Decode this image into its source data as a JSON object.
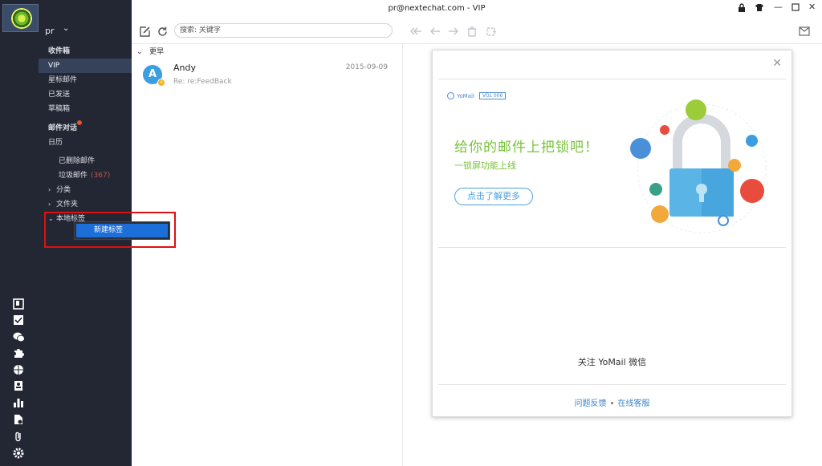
{
  "window": {
    "title": "pr@nextechat.com - VIP",
    "controls": [
      "lock-icon",
      "skin-icon",
      "minimize-icon",
      "maximize-icon",
      "close-icon"
    ]
  },
  "account": {
    "name": "pr"
  },
  "sidebar": {
    "items": [
      {
        "label": "收件箱"
      },
      {
        "label": "VIP"
      },
      {
        "label": "星标邮件"
      },
      {
        "label": "已发送"
      },
      {
        "label": "草稿箱"
      },
      {
        "label": "邮件对话"
      },
      {
        "label": "日历"
      },
      {
        "label": "已删除邮件"
      },
      {
        "label": "垃圾邮件",
        "count": "(367)"
      },
      {
        "label": "分类"
      },
      {
        "label": "文件夹"
      },
      {
        "label": "本地标签"
      }
    ],
    "bottom_icons": [
      "notes-icon",
      "tasks-icon",
      "wechat-icon",
      "puzzle-icon",
      "globe-icon",
      "contacts-icon",
      "stats-icon",
      "files-icon",
      "attachment-icon",
      "settings-icon"
    ]
  },
  "context_menu": {
    "items": [
      {
        "label": "新建标签"
      }
    ]
  },
  "toolbar": {
    "search_placeholder": "搜索: 关键字"
  },
  "mail_list": {
    "group_label": "更早",
    "items": [
      {
        "avatar_letter": "A",
        "sender": "Andy",
        "date": "2015-09-09",
        "subject": "Re: re:FeedBack"
      }
    ]
  },
  "reading_pane": {
    "logo_text": "YoMail",
    "vol_tag": "VOL 006",
    "banner_title": "给你的邮件上把锁吧！",
    "banner_subtitle": "一锁屏功能上线",
    "banner_button": "点击了解更多",
    "follow_text": "关注 YoMail 微信",
    "footer_links": [
      "问题反馈",
      "在线客服"
    ],
    "footer_sep": "•"
  }
}
